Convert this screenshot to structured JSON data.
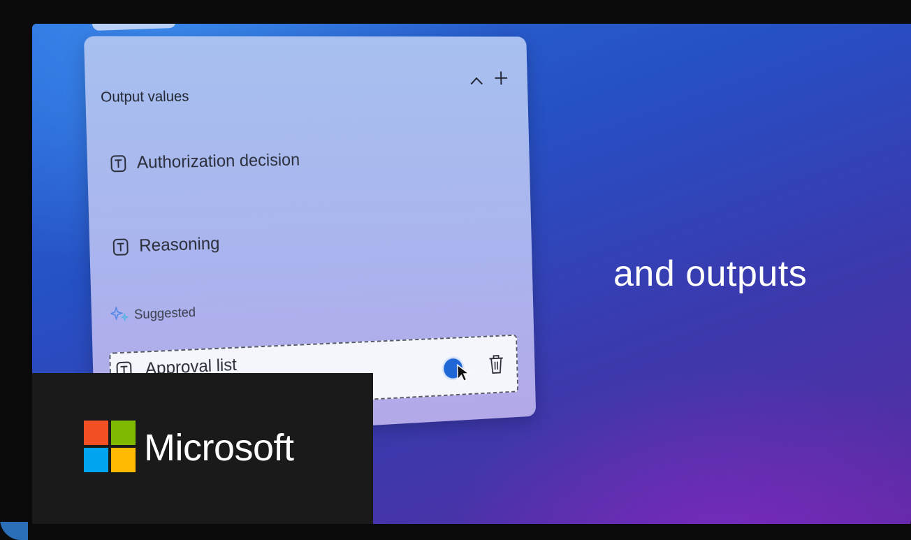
{
  "card": {
    "title": "Output values",
    "collapse_icon": "chevron-up-icon",
    "add_icon": "plus-icon",
    "fields": [
      {
        "label": "Authorization decision",
        "icon": "text-field-icon"
      },
      {
        "label": "Reasoning",
        "icon": "text-field-icon"
      }
    ],
    "suggested": {
      "label": "Suggested",
      "icon": "sparkle-icon",
      "item_label": "Approval list",
      "accept_icon": "accept-circle-icon",
      "delete_icon": "trash-icon"
    }
  },
  "headline": "and outputs",
  "branding": {
    "name": "Microsoft",
    "colors": {
      "red": "#f25022",
      "green": "#7fba00",
      "blue": "#00a4ef",
      "yellow": "#ffb900"
    }
  }
}
